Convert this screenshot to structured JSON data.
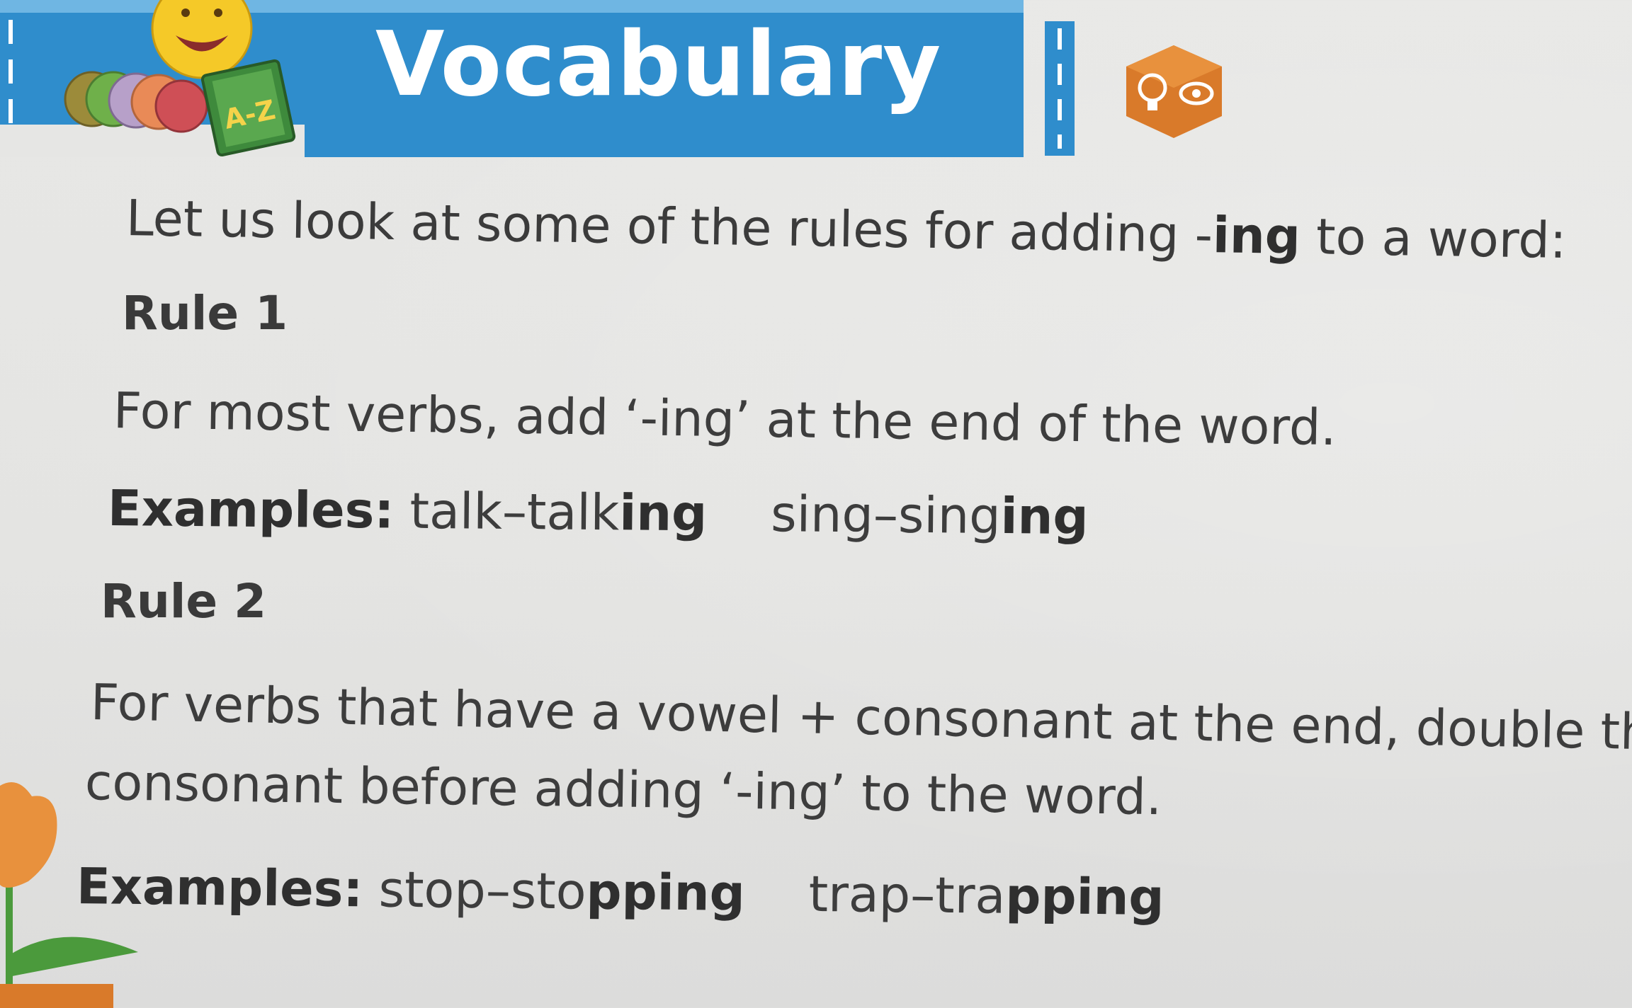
{
  "header": {
    "title": "Vocabulary",
    "mascot_book_label": "A-Z",
    "badge_icons": [
      "lightbulb-icon",
      "eye-icon"
    ],
    "colors": {
      "banner": "#2f8dcc",
      "badge": "#d97a2a",
      "book": "#3e8a3c",
      "mascot_face": "#f5c928"
    }
  },
  "intro": {
    "text_before": "Let us look at some of the rules for adding -",
    "suffix": "ing",
    "text_after": " to a word:"
  },
  "rules": [
    {
      "heading": "Rule 1",
      "text": "For most verbs, add ‘-ing’ at the end of the word.",
      "examples_label": "Examples:",
      "examples": [
        {
          "base": "talk",
          "dash": "–",
          "stem": "talk",
          "suffix": "ing"
        },
        {
          "base": "sing",
          "dash": "–",
          "stem": "sing",
          "suffix": "ing"
        }
      ]
    },
    {
      "heading": "Rule 2",
      "text_line1": "For verbs that have a vowel + consonant at the end, double the",
      "text_line2": "consonant before adding ‘-ing’ to the word.",
      "examples_label": "Examples:",
      "examples": [
        {
          "base": "stop",
          "dash": "–",
          "stem": "sto",
          "suffix": "pping"
        },
        {
          "base": "trap",
          "dash": "–",
          "stem": "tra",
          "suffix": "pping"
        }
      ]
    }
  ]
}
